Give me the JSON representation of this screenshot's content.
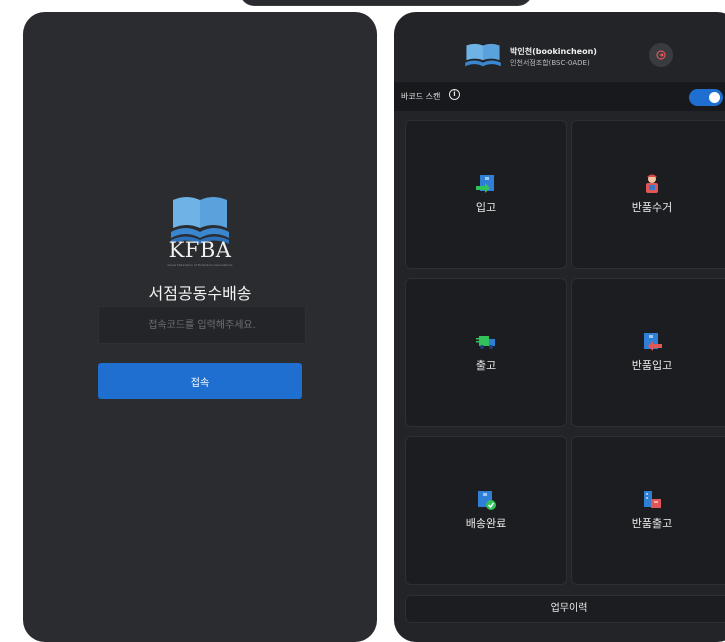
{
  "login": {
    "brand": "KFBA",
    "brand_sub": "Korea Federation of Bookstore Associations",
    "title": "서점공동수배송",
    "code_placeholder": "접속코드를 입력해주세요.",
    "connect_label": "접속"
  },
  "home": {
    "user_name": "박인천(bookincheon)",
    "user_sub": "인천서점조합(BSC-0ADE)",
    "scan_label": "바코드 스캔",
    "scan_enabled": true,
    "tiles": [
      {
        "label": "입고",
        "icon": "inbound-icon"
      },
      {
        "label": "반품수거",
        "icon": "return-pickup-icon"
      },
      {
        "label": "출고",
        "icon": "outbound-truck-icon"
      },
      {
        "label": "반품입고",
        "icon": "return-inbound-icon"
      },
      {
        "label": "배송완료",
        "icon": "delivery-complete-icon"
      },
      {
        "label": "반품출고",
        "icon": "return-outbound-icon"
      }
    ],
    "history_label": "업무이력"
  },
  "colors": {
    "accent": "#1f6fd0",
    "panel": "#2b2c30",
    "tile": "#1c1d20"
  }
}
